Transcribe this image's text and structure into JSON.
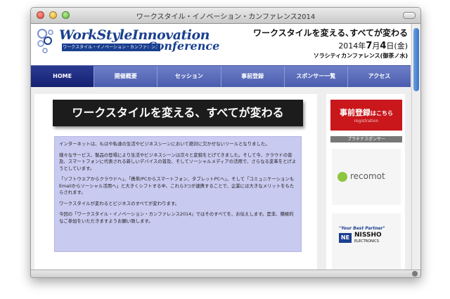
{
  "window": {
    "title": "ワークスタイル・イノベーション・カンファレンス2014"
  },
  "logo": {
    "line1": "WorkStyleInnovation",
    "sub": "ワークスタイル・イノベーション・カンファレンス",
    "line2": "Conference"
  },
  "header": {
    "tagline": "ワークスタイルを変える､すべてが変わる",
    "date_year": "2014年",
    "date_month": "7",
    "date_month_unit": "月",
    "date_day": "4",
    "date_day_unit": "日(金)",
    "venue": "ソラシティカンファレンス(御茶ノ水)"
  },
  "nav": {
    "items": [
      {
        "label": "HOME"
      },
      {
        "label": "開催概要"
      },
      {
        "label": "セッション"
      },
      {
        "label": "事前登録"
      },
      {
        "label": "スポンサー一覧"
      },
      {
        "label": "アクセス"
      }
    ]
  },
  "main": {
    "hero": "ワークスタイルを変える、すべてが変わる",
    "paragraphs": [
      "インターネットは、もはや私達の生活やビジネスシーンにおいて絶対に欠かせないツールとなりました。",
      "様々なサービス、製品の登場により生活やビジネスシーンは次々と変貌をとげてきました。そして今、クラウドの普及、スマートフォンに代表される新しいデバイスの普及、そしてソーシャルメディアの活用で、さらなる変革をとげようとしています。",
      "「ソフトウエアからクラウドへ」、「携帯/PCからスマートフォン、タブレットPCへ」、そして「コミュニケーションもEmailからソーシャル活用へ」と大きくシフトする中、これら3つが連携することで、企業には大きなメリットをもたらされます。",
      "ワークスタイルが変わるとビジネスのすべてが変わります。",
      "今回の「ワークスタイル・イノベーション・カンファレンス2014」ではそのすべてを、お伝えします。是非、積極的なご参加をいただきますようお願い致します。"
    ]
  },
  "sidebar": {
    "register_main": "事前登録",
    "register_suffix": "はこちら",
    "register_sub": "registration",
    "platinum_label": "プラチナスポンサー",
    "sponsor1": "recomot",
    "sponsor2_tagline": "\"Your Best Partner\"",
    "sponsor2_mark": "NE",
    "sponsor2_name": "NISSHO",
    "sponsor2_sub": "ELECTRONICS"
  }
}
